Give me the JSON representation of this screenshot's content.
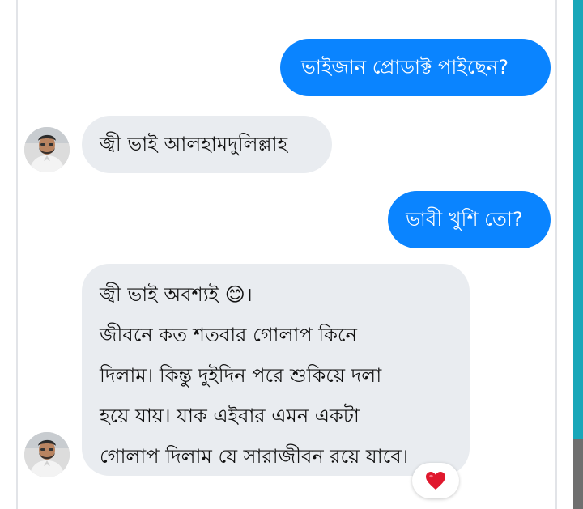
{
  "colors": {
    "outgoing_bubble": "#0a84ff",
    "incoming_bubble": "#e9ecf0",
    "accent_strip": "#19a7b9",
    "reaction_heart": "#e0182d"
  },
  "messages": [
    {
      "direction": "outgoing",
      "text": "ভাইজান প্রোডাক্ট পাইছেন?"
    },
    {
      "direction": "incoming",
      "text": "জ্বী ভাই আলহামদুলিল্লাহ"
    },
    {
      "direction": "outgoing",
      "text": "ভাবী খুশি তো?"
    },
    {
      "direction": "incoming",
      "lines": [
        "জ্বী ভাই অবশ্যই 😊।",
        "জীবনে কত শতবার গোলাপ কিনে",
        "দিলাম। কিন্তু দুইদিন পরে শুকিয়ে দলা",
        "হয়ে যায়। যাক এইবার এমন একটা",
        "গোলাপ দিলাম যে সারাজীবন রয়ে যাবে।"
      ],
      "reaction": "heart-icon"
    }
  ],
  "icons": {
    "avatar": "profile-photo",
    "reaction": "heart-icon"
  }
}
